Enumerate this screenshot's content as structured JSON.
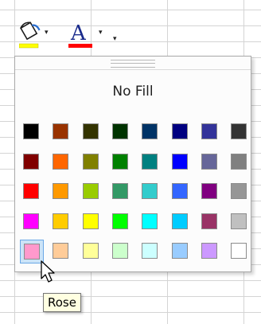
{
  "toolbar": {
    "fill_color_button": {
      "icon": "paint-bucket-icon",
      "current_color": "#ffff00"
    },
    "font_color_button": {
      "icon": "font-color-A-icon",
      "letter": "A",
      "current_color": "#ff0000"
    },
    "dropdown_glyph": "▾"
  },
  "palette": {
    "no_fill_label": "No Fill",
    "selected": "Rose",
    "rows": [
      [
        "#000000",
        "#993300",
        "#333300",
        "#003300",
        "#003366",
        "#000080",
        "#333399",
        "#333333"
      ],
      [
        "#800000",
        "#ff6600",
        "#808000",
        "#008000",
        "#008080",
        "#0000ff",
        "#666699",
        "#808080"
      ],
      [
        "#ff0000",
        "#ff9900",
        "#99cc00",
        "#339966",
        "#33cccc",
        "#3366ff",
        "#800080",
        "#969696"
      ],
      [
        "#ff00ff",
        "#ffcc00",
        "#ffff00",
        "#00ff00",
        "#00ffff",
        "#00ccff",
        "#993366",
        "#c0c0c0"
      ],
      [
        "#ff99cc",
        "#ffcc99",
        "#ffff99",
        "#ccffcc",
        "#ccffff",
        "#99ccff",
        "#cc99ff",
        "#ffffff"
      ]
    ]
  },
  "tooltip": {
    "text": "Rose"
  }
}
